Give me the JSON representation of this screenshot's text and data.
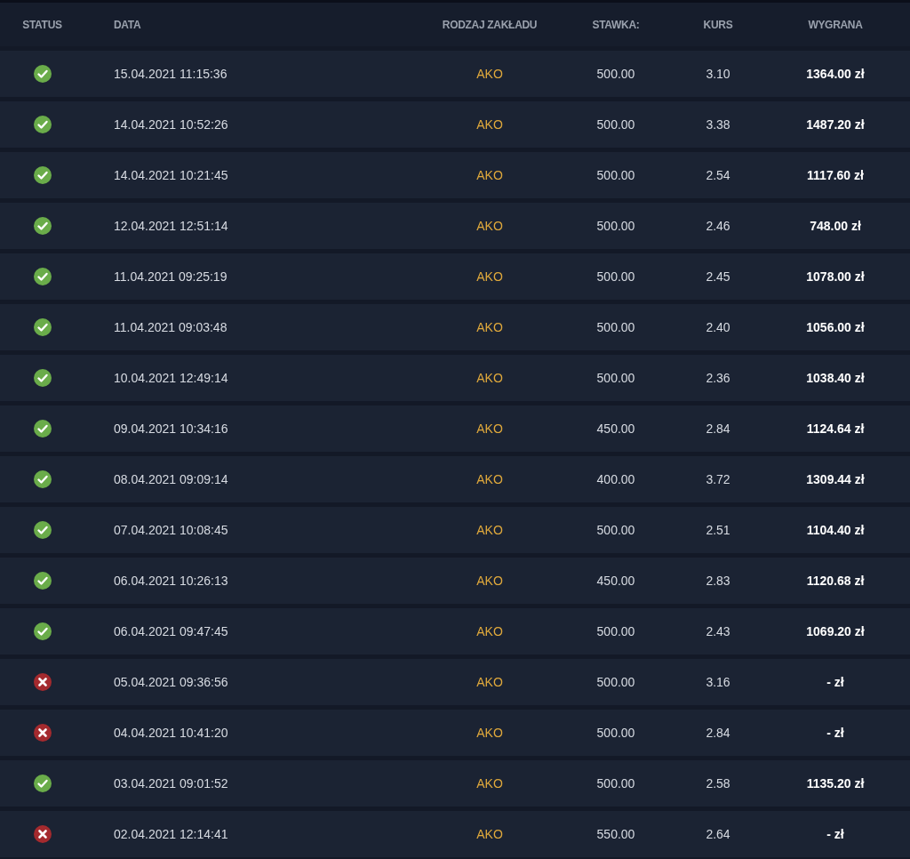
{
  "table": {
    "columns": [
      "STATUS",
      "DATA",
      "RODZAJ ZAKŁADU",
      "STAWKA:",
      "KURS",
      "WYGRANA"
    ],
    "rows": [
      {
        "kind": "won",
        "date": "15.04.2021 11:15:36",
        "type": "AKO",
        "stake": "500.00",
        "odds": "3.10",
        "win": "1364.00 zł"
      },
      {
        "kind": "won",
        "date": "14.04.2021 10:52:26",
        "type": "AKO",
        "stake": "500.00",
        "odds": "3.38",
        "win": "1487.20 zł"
      },
      {
        "kind": "won",
        "date": "14.04.2021 10:21:45",
        "type": "AKO",
        "stake": "500.00",
        "odds": "2.54",
        "win": "1117.60 zł"
      },
      {
        "kind": "won",
        "date": "12.04.2021 12:51:14",
        "type": "AKO",
        "stake": "500.00",
        "odds": "2.46",
        "win": "748.00 zł"
      },
      {
        "kind": "won",
        "date": "11.04.2021 09:25:19",
        "type": "AKO",
        "stake": "500.00",
        "odds": "2.45",
        "win": "1078.00 zł"
      },
      {
        "kind": "won",
        "date": "11.04.2021 09:03:48",
        "type": "AKO",
        "stake": "500.00",
        "odds": "2.40",
        "win": "1056.00 zł"
      },
      {
        "kind": "won",
        "date": "10.04.2021 12:49:14",
        "type": "AKO",
        "stake": "500.00",
        "odds": "2.36",
        "win": "1038.40 zł"
      },
      {
        "kind": "won",
        "date": "09.04.2021 10:34:16",
        "type": "AKO",
        "stake": "450.00",
        "odds": "2.84",
        "win": "1124.64 zł"
      },
      {
        "kind": "won",
        "date": "08.04.2021 09:09:14",
        "type": "AKO",
        "stake": "400.00",
        "odds": "3.72",
        "win": "1309.44 zł"
      },
      {
        "kind": "won",
        "date": "07.04.2021 10:08:45",
        "type": "AKO",
        "stake": "500.00",
        "odds": "2.51",
        "win": "1104.40 zł"
      },
      {
        "kind": "won",
        "date": "06.04.2021 10:26:13",
        "type": "AKO",
        "stake": "450.00",
        "odds": "2.83",
        "win": "1120.68 zł"
      },
      {
        "kind": "won",
        "date": "06.04.2021 09:47:45",
        "type": "AKO",
        "stake": "500.00",
        "odds": "2.43",
        "win": "1069.20 zł"
      },
      {
        "kind": "lost",
        "date": "05.04.2021 09:36:56",
        "type": "AKO",
        "stake": "500.00",
        "odds": "3.16",
        "win": "- zł"
      },
      {
        "kind": "lost",
        "date": "04.04.2021 10:41:20",
        "type": "AKO",
        "stake": "500.00",
        "odds": "2.84",
        "win": "- zł"
      },
      {
        "kind": "won",
        "date": "03.04.2021 09:01:52",
        "type": "AKO",
        "stake": "500.00",
        "odds": "2.58",
        "win": "1135.20 zł"
      },
      {
        "kind": "lost",
        "date": "02.04.2021 12:14:41",
        "type": "AKO",
        "stake": "550.00",
        "odds": "2.64",
        "win": "- zł"
      }
    ]
  }
}
